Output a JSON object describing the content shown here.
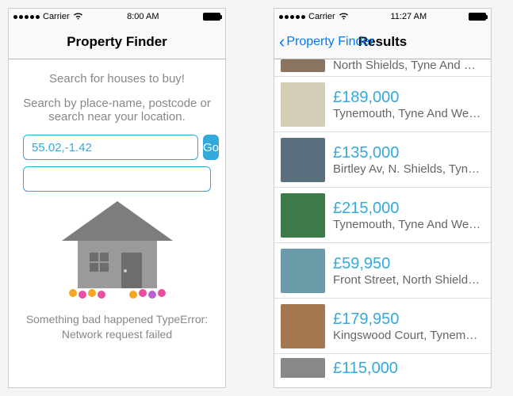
{
  "left": {
    "status": {
      "carrier": "Carrier",
      "wifi": "wifi",
      "time": "8:00 AM"
    },
    "nav": {
      "title": "Property Finder"
    },
    "intro_1": "Search for houses to buy!",
    "intro_2": "Search by place-name, postcode or search near your location.",
    "search_value": "55.02,-1.42",
    "go_label": "Go",
    "error": "Something bad happened TypeError: Network request failed"
  },
  "right": {
    "status": {
      "carrier": "Carrier",
      "wifi": "wifi",
      "time": "11:27 AM"
    },
    "nav": {
      "back": "Property Finder",
      "title": "Results"
    },
    "results": [
      {
        "price": "",
        "addr": "North Shields, Tyne And W…",
        "thumb_color": "#8b7560"
      },
      {
        "price": "£189,000",
        "addr": "Tynemouth, Tyne And Wear…",
        "thumb_color": "#d4cdb6"
      },
      {
        "price": "£135,000",
        "addr": "Birtley Av, N. Shields, Tyne…",
        "thumb_color": "#5a6f7d"
      },
      {
        "price": "£215,000",
        "addr": "Tynemouth, Tyne And Wear…",
        "thumb_color": "#3c7a4a"
      },
      {
        "price": "£59,950",
        "addr": "Front Street, North Shields,…",
        "thumb_color": "#6b9aa8"
      },
      {
        "price": "£179,950",
        "addr": "Kingswood Court, Tynemo…",
        "thumb_color": "#a67850"
      },
      {
        "price": "£115,000",
        "addr": "",
        "thumb_color": "#888888"
      }
    ]
  }
}
